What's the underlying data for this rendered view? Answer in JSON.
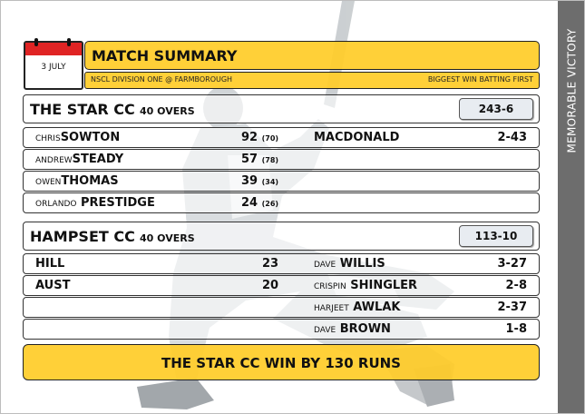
{
  "date": "3 JULY",
  "header": {
    "title": "MATCH SUMMARY",
    "competition": "NSCL DIVISION ONE @ FARMBOROUGH",
    "note": "BIGGEST WIN BATTING FIRST"
  },
  "sidebar_label": "MEMORABLE VICTORY",
  "team1": {
    "name": "THE STAR CC",
    "overs": "40 OVERS",
    "score": "243-6",
    "batting": [
      {
        "first": "CHRIS",
        "last": "SOWTON",
        "runs": "92",
        "balls": "(70)"
      },
      {
        "first": "ANDREW",
        "last": "STEADY",
        "runs": "57",
        "balls": "(78)"
      },
      {
        "first": "OWEN",
        "last": "THOMAS",
        "runs": "39",
        "balls": "(34)"
      },
      {
        "first": "ORLANDO",
        "last": "PRESTIDGE",
        "runs": "24",
        "balls": "(26)"
      }
    ],
    "bowling": [
      {
        "first": "",
        "last": "MACDONALD",
        "figures": "2-43"
      }
    ]
  },
  "team2": {
    "name": "HAMPSET CC",
    "overs": "40 OVERS",
    "score": "113-10",
    "batting": [
      {
        "first": "",
        "last": "HILL",
        "runs": "23"
      },
      {
        "first": "",
        "last": "AUST",
        "runs": "20"
      }
    ],
    "bowling": [
      {
        "first": "DAVE",
        "last": "WILLIS",
        "figures": "3-27"
      },
      {
        "first": "CRISPIN",
        "last": "SHINGLER",
        "figures": "2-8"
      },
      {
        "first": "HARJEET",
        "last": "AWLAK",
        "figures": "2-37"
      },
      {
        "first": "DAVE",
        "last": "BROWN",
        "figures": "1-8"
      }
    ]
  },
  "result": "THE STAR CC WIN BY 130 RUNS",
  "colors": {
    "accent": "#ffcc29",
    "sidebar": "#6d6d6d",
    "calendar": "#e02424"
  }
}
